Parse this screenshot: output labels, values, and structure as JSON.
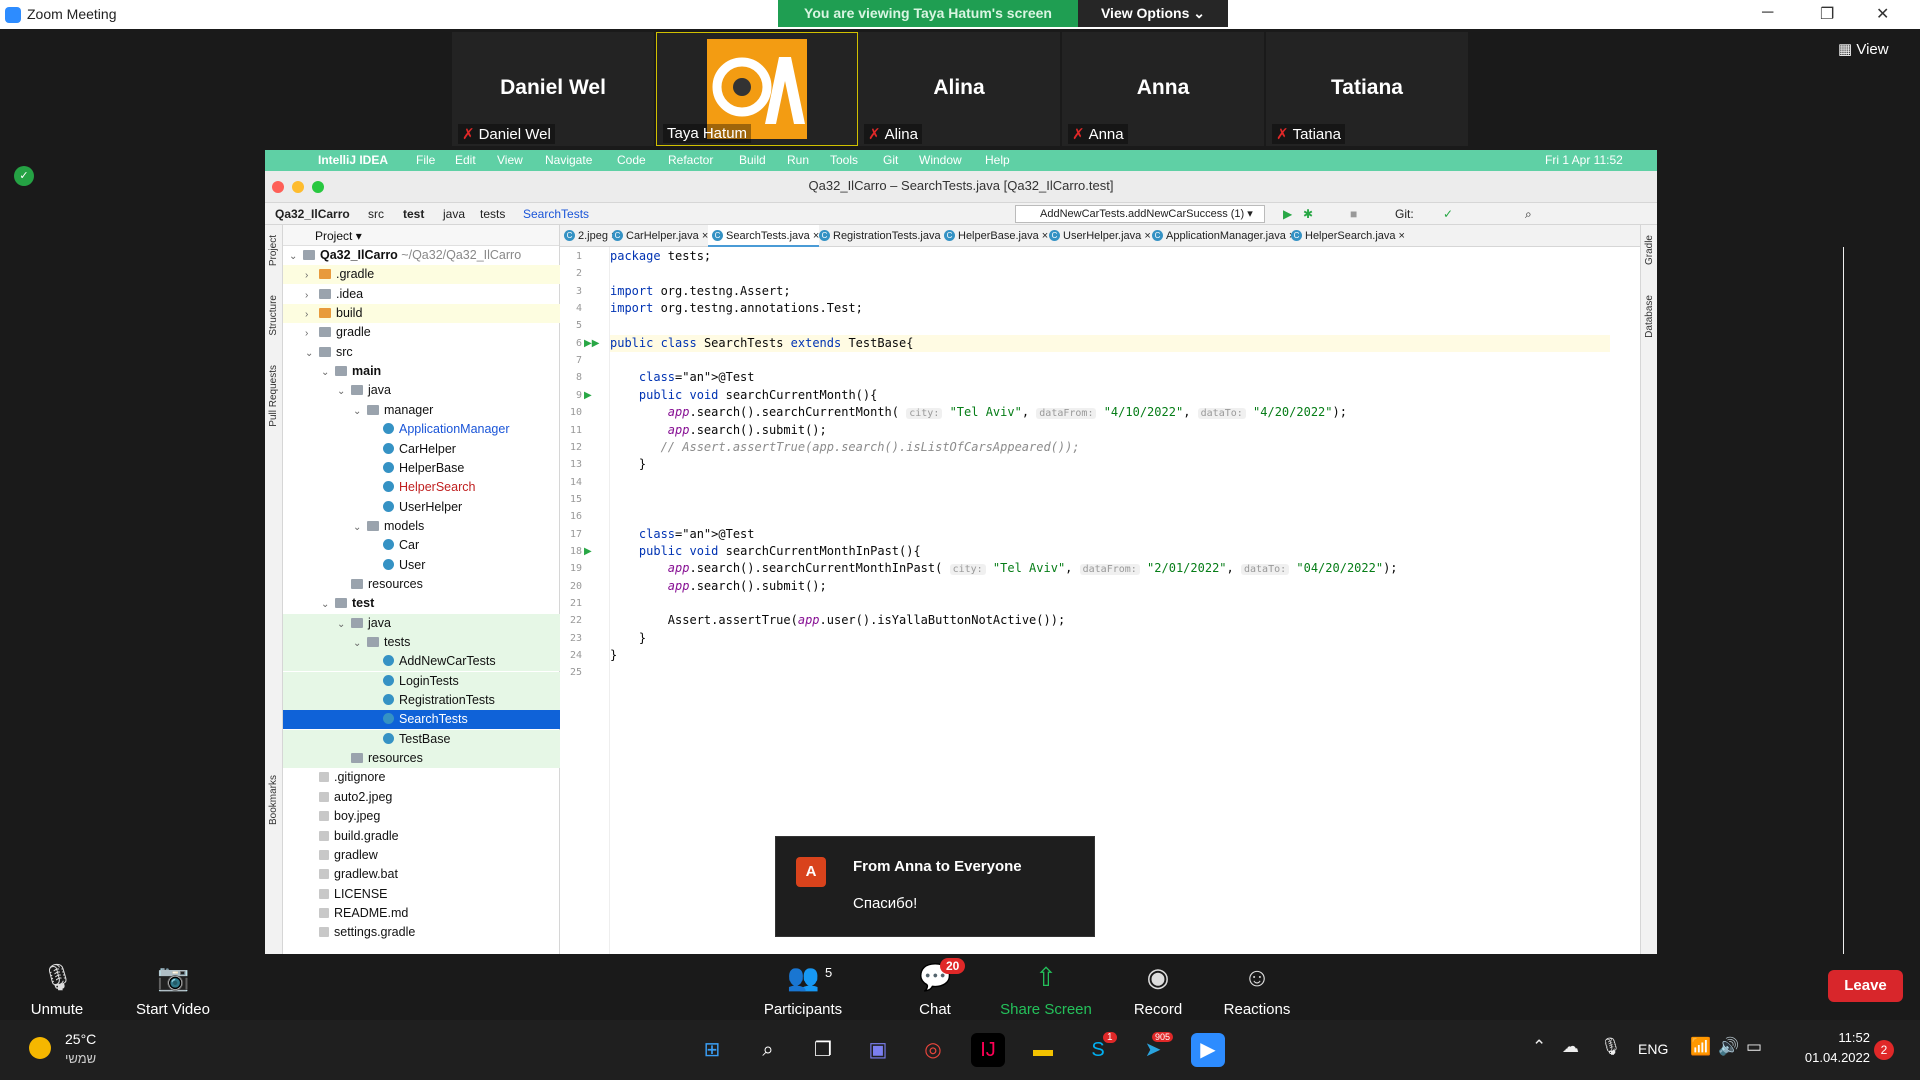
{
  "zoom": {
    "window_title": "Zoom Meeting",
    "banner": "You are viewing Taya Hatum's screen",
    "view_options": "View Options",
    "view_btn": "View",
    "participants": [
      {
        "big": "Daniel Wel",
        "name": "Daniel Wel"
      },
      {
        "big": "",
        "name": "Taya Hatum"
      },
      {
        "big": "Alina",
        "name": "Alina"
      },
      {
        "big": "Anna",
        "name": "Anna"
      },
      {
        "big": "Tatiana",
        "name": "Tatiana"
      }
    ],
    "controls": {
      "unmute": "Unmute",
      "start_video": "Start Video",
      "participants": "Participants",
      "participants_count": "5",
      "chat": "Chat",
      "chat_badge": "20",
      "share": "Share Screen",
      "record": "Record",
      "reactions": "Reactions",
      "leave": "Leave"
    },
    "chat_popup": {
      "avatar": "A",
      "from": "From Anna to Everyone",
      "message": "Спасибо!"
    }
  },
  "ide": {
    "menubar": [
      "IntelliJ IDEA",
      "File",
      "Edit",
      "View",
      "Navigate",
      "Code",
      "Refactor",
      "Build",
      "Run",
      "Tools",
      "Git",
      "Window",
      "Help"
    ],
    "clock": "Fri 1 Apr  11:52",
    "title": "Qa32_IlCarro – SearchTests.java [Qa32_IlCarro.test]",
    "breadcrumbs": [
      "Qa32_IlCarro",
      "src",
      "test",
      "java",
      "tests",
      "SearchTests"
    ],
    "run_config": "AddNewCarTests.addNewCarSuccess (1)",
    "git_label": "Git:",
    "strip_left": [
      "Project",
      "Structure",
      "Pull Requests",
      "Bookmarks"
    ],
    "strip_right": [
      "Gradle",
      "Database"
    ],
    "project_header": "Project",
    "tree": [
      {
        "t": "Qa32_IlCarro",
        "extra": "~/Qa32/Qa32_IlCarro",
        "d": 0,
        "a": "v",
        "ic": "fold",
        "bold": true,
        "row": ""
      },
      {
        "t": ".gradle",
        "d": 1,
        "a": ">",
        "ic": "fold-or",
        "row": "yl"
      },
      {
        "t": ".idea",
        "d": 1,
        "a": ">",
        "ic": "fold",
        "row": ""
      },
      {
        "t": "build",
        "d": 1,
        "a": ">",
        "ic": "fold-or",
        "row": "yl"
      },
      {
        "t": "gradle",
        "d": 1,
        "a": ">",
        "ic": "fold",
        "row": ""
      },
      {
        "t": "src",
        "d": 1,
        "a": "v",
        "ic": "fold",
        "row": ""
      },
      {
        "t": "main",
        "d": 2,
        "a": "v",
        "ic": "fold",
        "bold": true,
        "row": ""
      },
      {
        "t": "java",
        "d": 3,
        "a": "v",
        "ic": "fold",
        "row": ""
      },
      {
        "t": "manager",
        "d": 4,
        "a": "v",
        "ic": "fold",
        "row": ""
      },
      {
        "t": "ApplicationManager",
        "d": 5,
        "a": "",
        "ic": "cls",
        "row": "",
        "c": "#1a55d8"
      },
      {
        "t": "CarHelper",
        "d": 5,
        "a": "",
        "ic": "cls",
        "row": ""
      },
      {
        "t": "HelperBase",
        "d": 5,
        "a": "",
        "ic": "cls",
        "row": ""
      },
      {
        "t": "HelperSearch",
        "d": 5,
        "a": "",
        "ic": "cls",
        "row": "",
        "c": "#c02020"
      },
      {
        "t": "UserHelper",
        "d": 5,
        "a": "",
        "ic": "cls",
        "row": ""
      },
      {
        "t": "models",
        "d": 4,
        "a": "v",
        "ic": "fold",
        "row": ""
      },
      {
        "t": "Car",
        "d": 5,
        "a": "",
        "ic": "cls",
        "row": ""
      },
      {
        "t": "User",
        "d": 5,
        "a": "",
        "ic": "cls",
        "row": ""
      },
      {
        "t": "resources",
        "d": 3,
        "a": "",
        "ic": "fold",
        "row": ""
      },
      {
        "t": "test",
        "d": 2,
        "a": "v",
        "ic": "fold",
        "bold": true,
        "row": ""
      },
      {
        "t": "java",
        "d": 3,
        "a": "v",
        "ic": "fold",
        "row": "hl"
      },
      {
        "t": "tests",
        "d": 4,
        "a": "v",
        "ic": "fold",
        "row": "hl"
      },
      {
        "t": "AddNewCarTests",
        "d": 5,
        "a": "",
        "ic": "cls",
        "row": "hl"
      },
      {
        "t": "LoginTests",
        "d": 5,
        "a": "",
        "ic": "cls",
        "row": "hl"
      },
      {
        "t": "RegistrationTests",
        "d": 5,
        "a": "",
        "ic": "cls",
        "row": "hl"
      },
      {
        "t": "SearchTests",
        "d": 5,
        "a": "",
        "ic": "cls",
        "row": "sel"
      },
      {
        "t": "TestBase",
        "d": 5,
        "a": "",
        "ic": "cls",
        "row": "hl"
      },
      {
        "t": "resources",
        "d": 3,
        "a": "",
        "ic": "fold",
        "row": "hl"
      },
      {
        "t": ".gitignore",
        "d": 1,
        "a": "",
        "ic": "file",
        "row": ""
      },
      {
        "t": "auto2.jpeg",
        "d": 1,
        "a": "",
        "ic": "file",
        "row": ""
      },
      {
        "t": "boy.jpeg",
        "d": 1,
        "a": "",
        "ic": "file",
        "row": ""
      },
      {
        "t": "build.gradle",
        "d": 1,
        "a": "",
        "ic": "file",
        "row": ""
      },
      {
        "t": "gradlew",
        "d": 1,
        "a": "",
        "ic": "file",
        "row": ""
      },
      {
        "t": "gradlew.bat",
        "d": 1,
        "a": "",
        "ic": "file",
        "row": ""
      },
      {
        "t": "LICENSE",
        "d": 1,
        "a": "",
        "ic": "file",
        "row": ""
      },
      {
        "t": "README.md",
        "d": 1,
        "a": "",
        "ic": "file",
        "row": ""
      },
      {
        "t": "settings.gradle",
        "d": 1,
        "a": "",
        "ic": "file",
        "row": ""
      }
    ],
    "tabs": [
      "2.jpeg",
      "CarHelper.java",
      "SearchTests.java",
      "RegistrationTests.java",
      "HelperBase.java",
      "UserHelper.java",
      "ApplicationManager.java",
      "HelperSearch.java"
    ],
    "active_tab": "SearchTests.java",
    "code": [
      "package tests;",
      "",
      "import org.testng.Assert;",
      "import org.testng.annotations.Test;",
      "",
      "public class SearchTests extends TestBase{",
      "",
      "    @Test",
      "    public void searchCurrentMonth(){",
      "        app.search().searchCurrentMonth(",
      "        app.search().submit();",
      "       // Assert.assertTrue(app.search().isListOfCarsAppeared());",
      "    }",
      "",
      "",
      "",
      "    @Test",
      "    public void searchCurrentMonthInPast(){",
      "        app.search().searchCurrentMonthInPast(",
      "        app.search().submit();",
      "",
      "        Assert.assertTrue(app.user().isYallaButtonNotActive());",
      "    }",
      "}",
      ""
    ],
    "call1": {
      "city_hint": "city:",
      "city": "\"Tel Aviv\"",
      "from_hint": "dataFrom:",
      "from": "\"4/10/2022\"",
      "to_hint": "dataTo:",
      "to": "\"4/20/2022\"",
      "end": ");"
    },
    "call2": {
      "city_hint": "city:",
      "city": "\"Tel Aviv\"",
      "from_hint": "dataFrom:",
      "from": "\"2/01/2022\"",
      "to_hint": "dataTo:",
      "to": "\"04/20/2022\"",
      "end": ");"
    }
  },
  "taskbar": {
    "temp": "25°C",
    "weather_desc": "שמשי",
    "lang": "ENG",
    "time": "11:52",
    "date": "01.04.2022",
    "notifications": "2",
    "skype_badge": "1",
    "telegram_badge": "905"
  }
}
